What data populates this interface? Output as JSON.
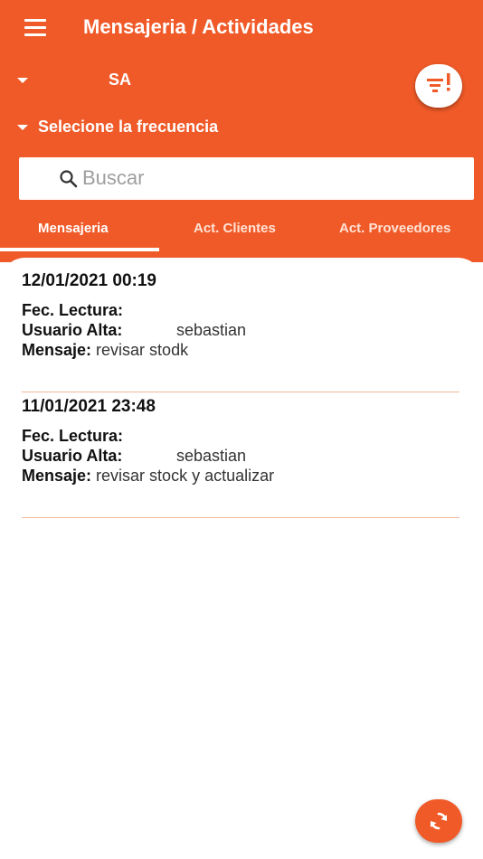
{
  "colors": {
    "primary": "#f05a28",
    "surface": "#ffffff",
    "divider": "#f0b89a"
  },
  "header": {
    "title": "Mensajeria / Actividades",
    "menu_icon": "hamburger-menu-icon",
    "company_value": "SA",
    "frequency_label": "Selecione la frecuencia",
    "filter_icon": "filter-alert-icon"
  },
  "search": {
    "placeholder": "Buscar",
    "value": "",
    "icon": "search-icon"
  },
  "tabs": [
    {
      "label": "Mensajeria",
      "active": true
    },
    {
      "label": "Act. Clientes",
      "active": false
    },
    {
      "label": "Act. Proveedores",
      "active": false
    }
  ],
  "labels": {
    "read_date": "Fec. Lectura:",
    "created_by": "Usuario Alta:",
    "message": "Mensaje:"
  },
  "messages": [
    {
      "date": "12/01/2021 00:19",
      "read_date": "",
      "created_by": "sebastian",
      "message": "revisar stodk"
    },
    {
      "date": "11/01/2021 23:48",
      "read_date": "",
      "created_by": "sebastian",
      "message": "revisar stock y actualizar"
    }
  ],
  "fab": {
    "icon": "refresh-icon"
  }
}
